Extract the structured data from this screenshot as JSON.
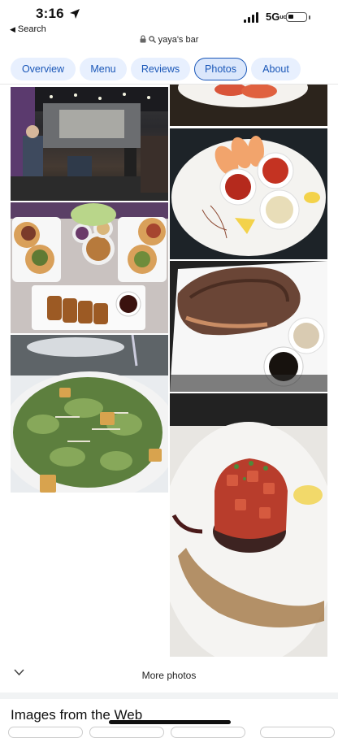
{
  "status_bar": {
    "time": "3:16",
    "back_label": "Search",
    "network": "5G",
    "network_suffix": "uc"
  },
  "address": {
    "query": "yaya's bar"
  },
  "tabs": [
    {
      "label": "Overview",
      "active": false
    },
    {
      "label": "Menu",
      "active": false
    },
    {
      "label": "Reviews",
      "active": false
    },
    {
      "label": "Photos",
      "active": true
    },
    {
      "label": "About",
      "active": false
    }
  ],
  "colors": {
    "accent": "#1a57b8",
    "tab_bg": "#e8f0fe"
  },
  "photos": [
    {
      "subject": "plated dish top (cropped)"
    },
    {
      "subject": "restaurant interior"
    },
    {
      "subject": "shrimp with dipping sauces"
    },
    {
      "subject": "tacos and fried rolls"
    },
    {
      "subject": "steak with sauces"
    },
    {
      "subject": "caesar salad"
    },
    {
      "subject": "tuna tartare"
    }
  ],
  "more_photos": {
    "label": "More photos"
  },
  "web_section": {
    "title": "Images from the Web"
  }
}
